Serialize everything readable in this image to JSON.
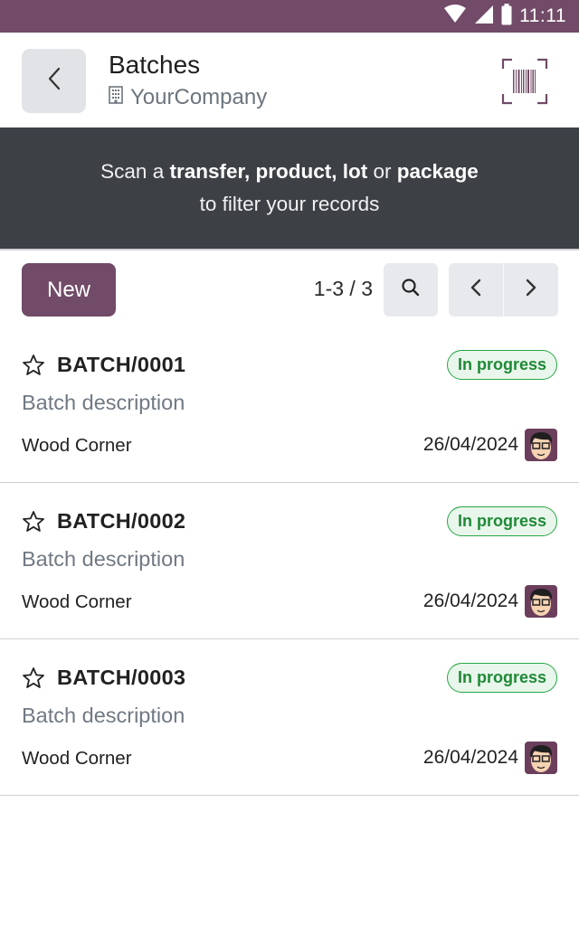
{
  "status_bar": {
    "time": "11:11",
    "icons": [
      "wifi-icon",
      "cellular-signal-icon",
      "battery-icon"
    ]
  },
  "header": {
    "back_icon": "chevron-left-icon",
    "title": "Batches",
    "company_icon": "building-icon",
    "company": "YourCompany",
    "scan_icon": "barcode-scanner-icon"
  },
  "banner": {
    "prefix": "Scan a ",
    "bold1": "transfer, product, lot",
    "middle": " or ",
    "bold2": "package",
    "line2": "to filter your records"
  },
  "toolbar": {
    "new_label": "New",
    "pager_value": "1-3 / 3",
    "search_icon": "search-icon",
    "prev_icon": "chevron-left-icon",
    "next_icon": "chevron-right-icon"
  },
  "records": [
    {
      "name": "BATCH/0001",
      "status": "In progress",
      "description": "Batch description",
      "partner": "Wood Corner",
      "date": "26/04/2024",
      "favorite": false
    },
    {
      "name": "BATCH/0002",
      "status": "In progress",
      "description": "Batch description",
      "partner": "Wood Corner",
      "date": "26/04/2024",
      "favorite": false
    },
    {
      "name": "BATCH/0003",
      "status": "In progress",
      "description": "Batch description",
      "partner": "Wood Corner",
      "date": "26/04/2024",
      "favorite": false
    }
  ],
  "colors": {
    "brand": "#714b67",
    "banner_bg": "#3d4146",
    "status_green": "#28a745",
    "status_green_bg": "#e9f6ec"
  }
}
